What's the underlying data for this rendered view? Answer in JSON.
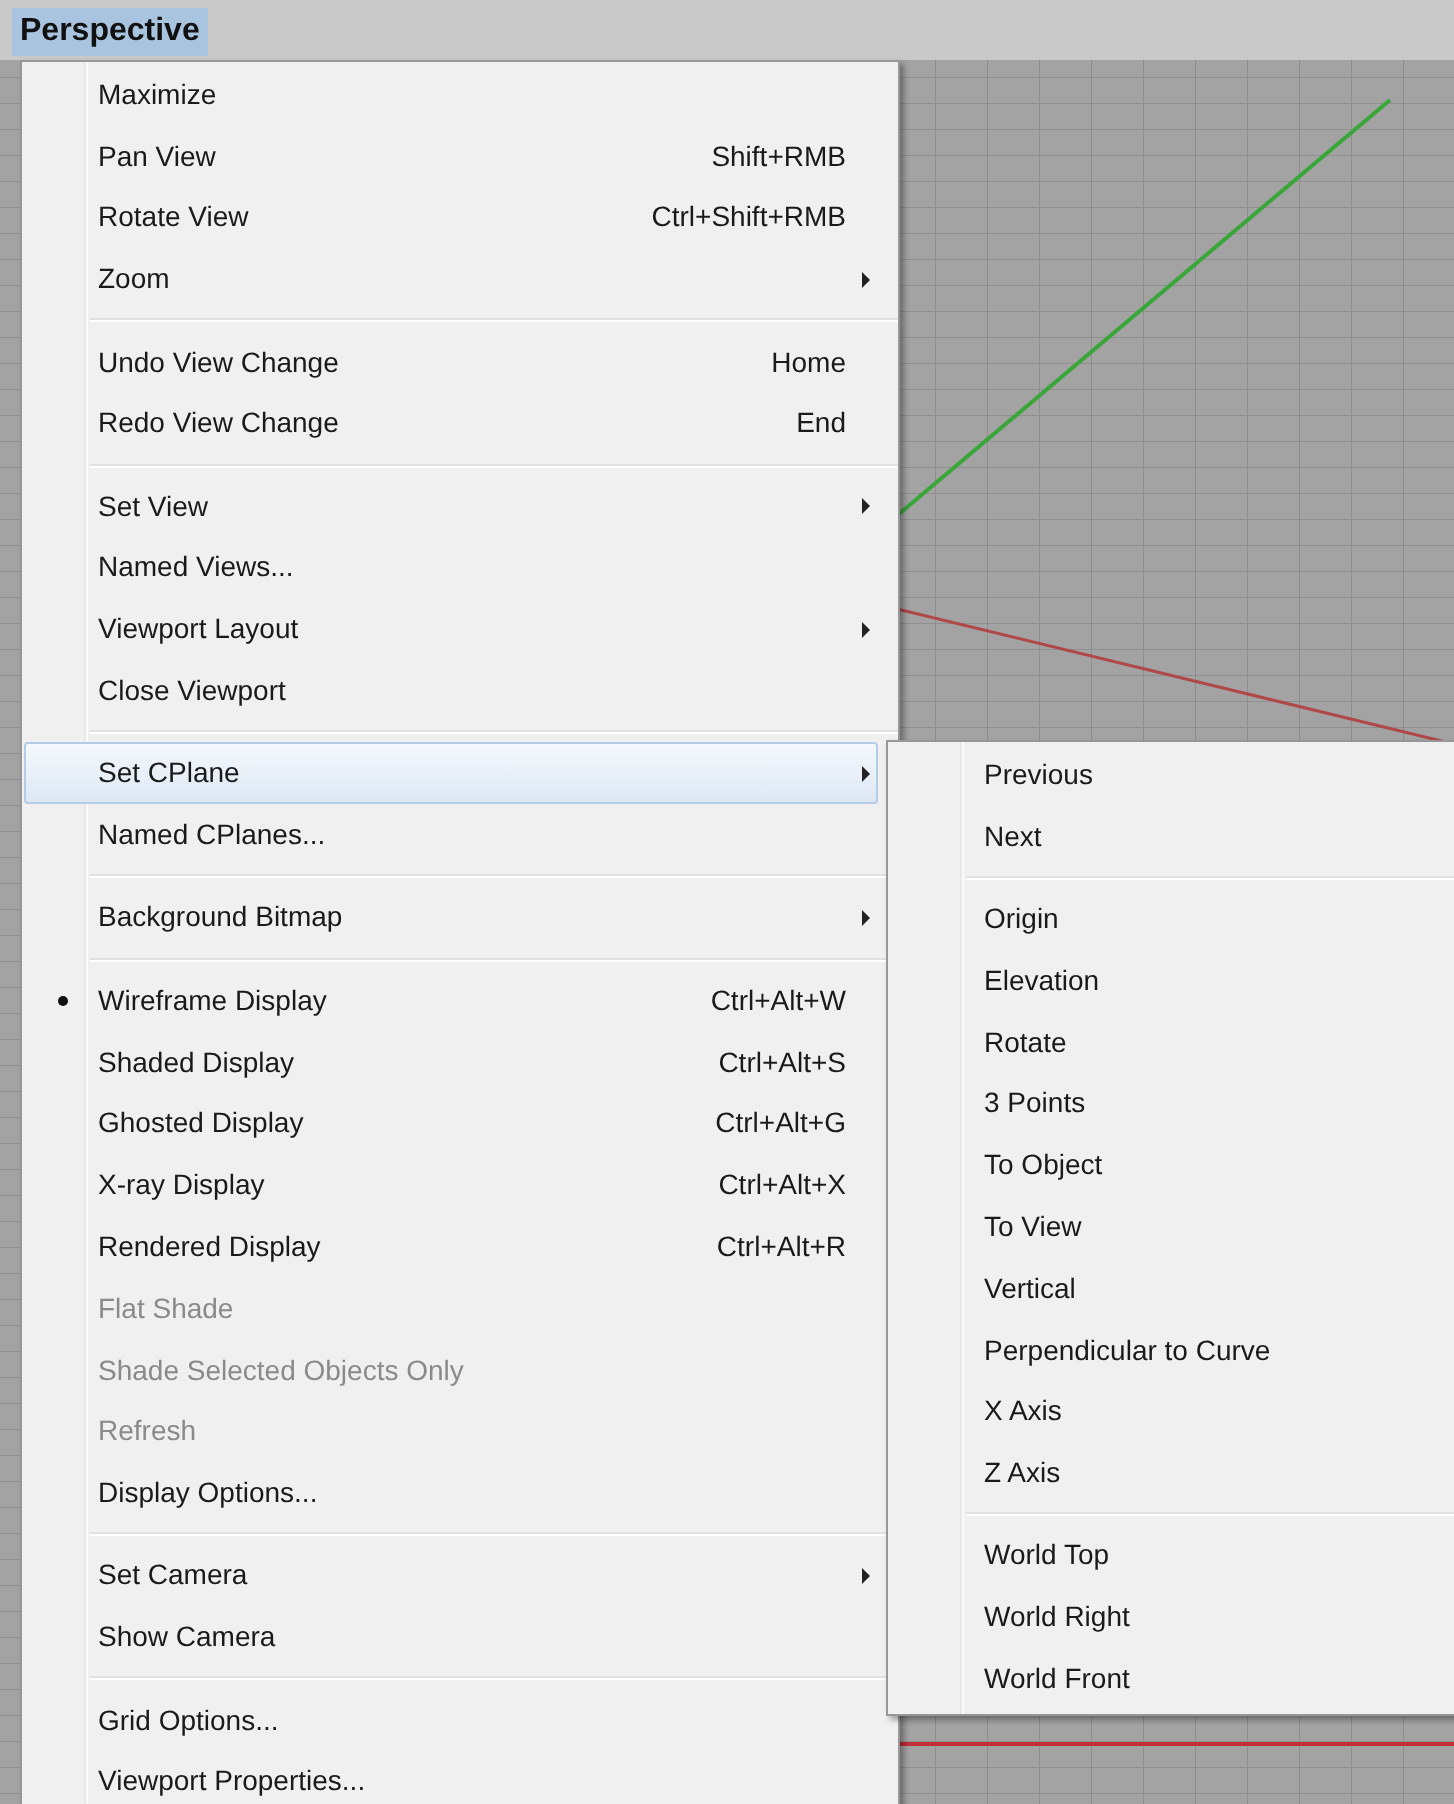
{
  "viewport": {
    "title": "Perspective"
  },
  "menu": {
    "groups": [
      [
        {
          "label": "Maximize",
          "submenu": false,
          "disabled": false,
          "checked": false,
          "selected": false
        },
        {
          "label": "Pan View",
          "shortcut": "Shift+RMB",
          "submenu": false,
          "disabled": false,
          "checked": false,
          "selected": false
        },
        {
          "label": "Rotate View",
          "shortcut": "Ctrl+Shift+RMB",
          "submenu": false,
          "disabled": false,
          "checked": false,
          "selected": false
        },
        {
          "label": "Zoom",
          "submenu": true,
          "disabled": false,
          "checked": false,
          "selected": false
        }
      ],
      [
        {
          "label": "Undo View Change",
          "shortcut": "Home",
          "submenu": false,
          "disabled": false,
          "checked": false,
          "selected": false
        },
        {
          "label": "Redo View Change",
          "shortcut": "End",
          "submenu": false,
          "disabled": false,
          "checked": false,
          "selected": false
        }
      ],
      [
        {
          "label": "Set View",
          "submenu": true,
          "disabled": false,
          "checked": false,
          "selected": false
        },
        {
          "label": "Named Views...",
          "submenu": false,
          "disabled": false,
          "checked": false,
          "selected": false
        },
        {
          "label": "Viewport Layout",
          "submenu": true,
          "disabled": false,
          "checked": false,
          "selected": false
        },
        {
          "label": "Close Viewport",
          "submenu": false,
          "disabled": false,
          "checked": false,
          "selected": false
        }
      ],
      [
        {
          "label": "Set CPlane",
          "submenu": true,
          "disabled": false,
          "checked": false,
          "selected": true
        },
        {
          "label": "Named CPlanes...",
          "submenu": false,
          "disabled": false,
          "checked": false,
          "selected": false
        }
      ],
      [
        {
          "label": "Background Bitmap",
          "submenu": true,
          "disabled": false,
          "checked": false,
          "selected": false
        }
      ],
      [
        {
          "label": "Wireframe Display",
          "shortcut": "Ctrl+Alt+W",
          "submenu": false,
          "disabled": false,
          "checked": true,
          "selected": false
        },
        {
          "label": "Shaded Display",
          "shortcut": "Ctrl+Alt+S",
          "submenu": false,
          "disabled": false,
          "checked": false,
          "selected": false
        },
        {
          "label": "Ghosted Display",
          "shortcut": "Ctrl+Alt+G",
          "submenu": false,
          "disabled": false,
          "checked": false,
          "selected": false
        },
        {
          "label": "X-ray Display",
          "shortcut": "Ctrl+Alt+X",
          "submenu": false,
          "disabled": false,
          "checked": false,
          "selected": false
        },
        {
          "label": "Rendered Display",
          "shortcut": "Ctrl+Alt+R",
          "submenu": false,
          "disabled": false,
          "checked": false,
          "selected": false
        },
        {
          "label": "Flat Shade",
          "submenu": false,
          "disabled": true,
          "checked": false,
          "selected": false
        },
        {
          "label": "Shade Selected Objects Only",
          "submenu": false,
          "disabled": true,
          "checked": false,
          "selected": false
        },
        {
          "label": "Refresh",
          "submenu": false,
          "disabled": true,
          "checked": false,
          "selected": false
        },
        {
          "label": "Display Options...",
          "submenu": false,
          "disabled": false,
          "checked": false,
          "selected": false
        }
      ],
      [
        {
          "label": "Set Camera",
          "submenu": true,
          "disabled": false,
          "checked": false,
          "selected": false
        },
        {
          "label": "Show Camera",
          "submenu": false,
          "disabled": false,
          "checked": false,
          "selected": false
        }
      ],
      [
        {
          "label": "Grid Options...",
          "submenu": false,
          "disabled": false,
          "checked": false,
          "selected": false
        },
        {
          "label": "Viewport Properties...",
          "submenu": false,
          "disabled": false,
          "checked": false,
          "selected": false
        }
      ]
    ]
  },
  "submenu": {
    "groups": [
      [
        {
          "label": "Previous"
        },
        {
          "label": "Next"
        }
      ],
      [
        {
          "label": "Origin"
        },
        {
          "label": "Elevation"
        },
        {
          "label": "Rotate"
        },
        {
          "label": "3 Points"
        },
        {
          "label": "To Object"
        },
        {
          "label": "To View"
        },
        {
          "label": "Vertical"
        },
        {
          "label": "Perpendicular to Curve"
        },
        {
          "label": "X Axis"
        },
        {
          "label": "Z Axis"
        }
      ],
      [
        {
          "label": "World Top"
        },
        {
          "label": "World Right"
        },
        {
          "label": "World Front"
        }
      ]
    ]
  }
}
